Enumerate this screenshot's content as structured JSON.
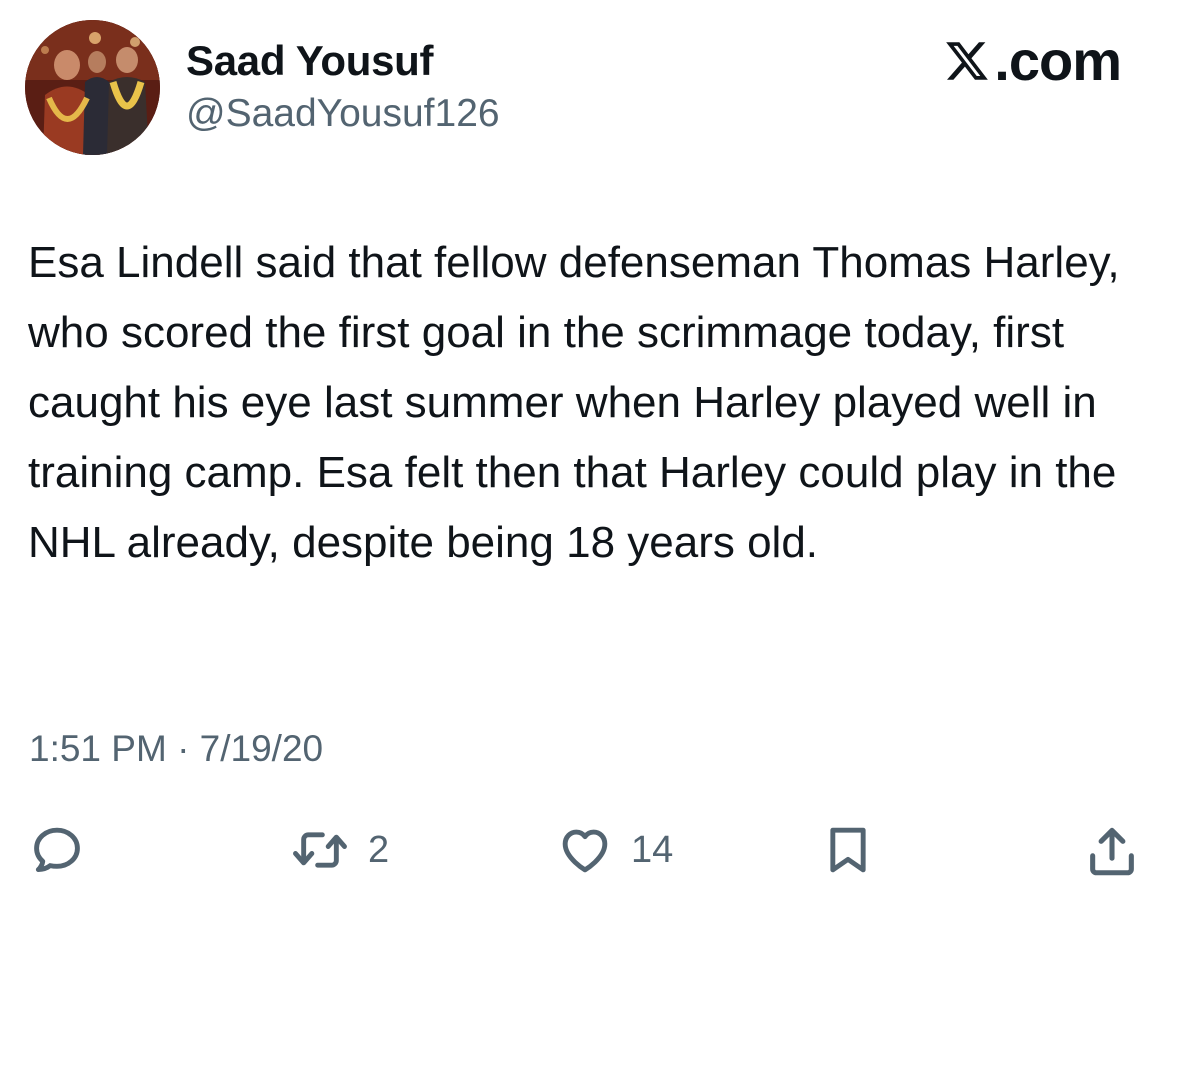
{
  "author": {
    "display_name": "Saad Yousuf",
    "handle": "@SaadYousuf126",
    "avatar_icon": "profile-photo"
  },
  "brand": {
    "suffix": ".com",
    "icon": "x-logo-icon"
  },
  "tweet": {
    "text": "Esa Lindell said that fellow defenseman Thomas Harley, who scored the first goal in the scrimmage today, first caught his eye last summer when Harley played well in training camp. Esa felt then that Harley could play in the NHL already, despite being 18 years old.",
    "timestamp": "1:51 PM · 7/19/20"
  },
  "actions": {
    "reply": {
      "icon": "reply-icon",
      "count": ""
    },
    "retweet": {
      "icon": "retweet-icon",
      "count": "2"
    },
    "like": {
      "icon": "heart-icon",
      "count": "14"
    },
    "bookmark": {
      "icon": "bookmark-icon"
    },
    "share": {
      "icon": "share-icon"
    }
  },
  "colors": {
    "text_primary": "#0f1419",
    "text_secondary": "#536471",
    "background": "#ffffff"
  }
}
